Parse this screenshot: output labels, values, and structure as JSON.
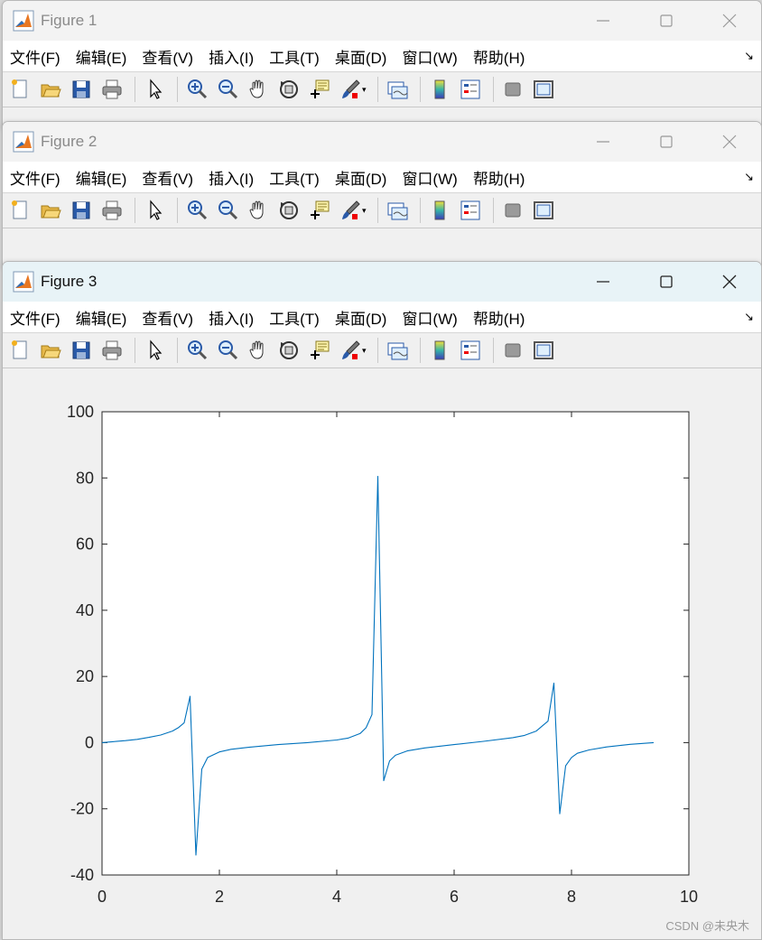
{
  "figures": [
    {
      "title": "Figure 1",
      "active": false
    },
    {
      "title": "Figure 2",
      "active": false
    },
    {
      "title": "Figure 3",
      "active": true
    }
  ],
  "menu": [
    "文件(F)",
    "编辑(E)",
    "查看(V)",
    "插入(I)",
    "工具(T)",
    "桌面(D)",
    "窗口(W)",
    "帮助(H)"
  ],
  "toolbar_icons": [
    "new-figure-icon",
    "open-file-icon",
    "save-icon",
    "print-icon",
    "|",
    "edit-plot-pointer-icon",
    "|",
    "zoom-in-icon",
    "zoom-out-icon",
    "pan-hand-icon",
    "rotate-3d-icon",
    "data-cursor-icon",
    "brush-icon",
    "|",
    "link-plot-icon",
    "|",
    "colorbar-icon",
    "legend-icon",
    "|",
    "hide-plot-tools-icon",
    "show-plot-tools-icon"
  ],
  "watermark": "CSDN @未央木",
  "colors": {
    "line": "#0072bd",
    "axes_bg": "#ffffff",
    "figure_bg": "#f0f0f0"
  },
  "chart_data": {
    "type": "line",
    "title": "",
    "xlabel": "",
    "ylabel": "",
    "xlim": [
      0,
      10
    ],
    "ylim": [
      -40,
      100
    ],
    "xticks": [
      0,
      2,
      4,
      6,
      8,
      10
    ],
    "yticks": [
      -40,
      -20,
      0,
      20,
      40,
      60,
      80,
      100
    ],
    "grid": false,
    "box": true,
    "series": [
      {
        "x": [
          0,
          0.2,
          0.4,
          0.6,
          0.8,
          1.0,
          1.2,
          1.3,
          1.4,
          1.5,
          1.6,
          1.7,
          1.8,
          2.0,
          2.2,
          2.5,
          3.0,
          3.5,
          4.0,
          4.2,
          4.4,
          4.5,
          4.6,
          4.7,
          4.8,
          4.9,
          5.0,
          5.2,
          5.5,
          6.0,
          6.5,
          7.0,
          7.2,
          7.4,
          7.5,
          7.6,
          7.7,
          7.8,
          7.9,
          8.0,
          8.1,
          8.3,
          8.6,
          9.0,
          9.4
        ],
        "y": [
          0,
          0.3,
          0.6,
          1,
          1.6,
          2.3,
          3.5,
          4.5,
          6,
          14,
          -34,
          -8,
          -4.5,
          -2.8,
          -2,
          -1.4,
          -0.6,
          0,
          0.8,
          1.4,
          2.8,
          4.5,
          8.5,
          80.5,
          -11.5,
          -5.5,
          -3.8,
          -2.5,
          -1.6,
          -0.6,
          0.4,
          1.5,
          2.2,
          3.5,
          5,
          6.5,
          18,
          -21.5,
          -7,
          -4.5,
          -3.2,
          -2.2,
          -1.3,
          -0.5,
          0
        ]
      }
    ]
  }
}
